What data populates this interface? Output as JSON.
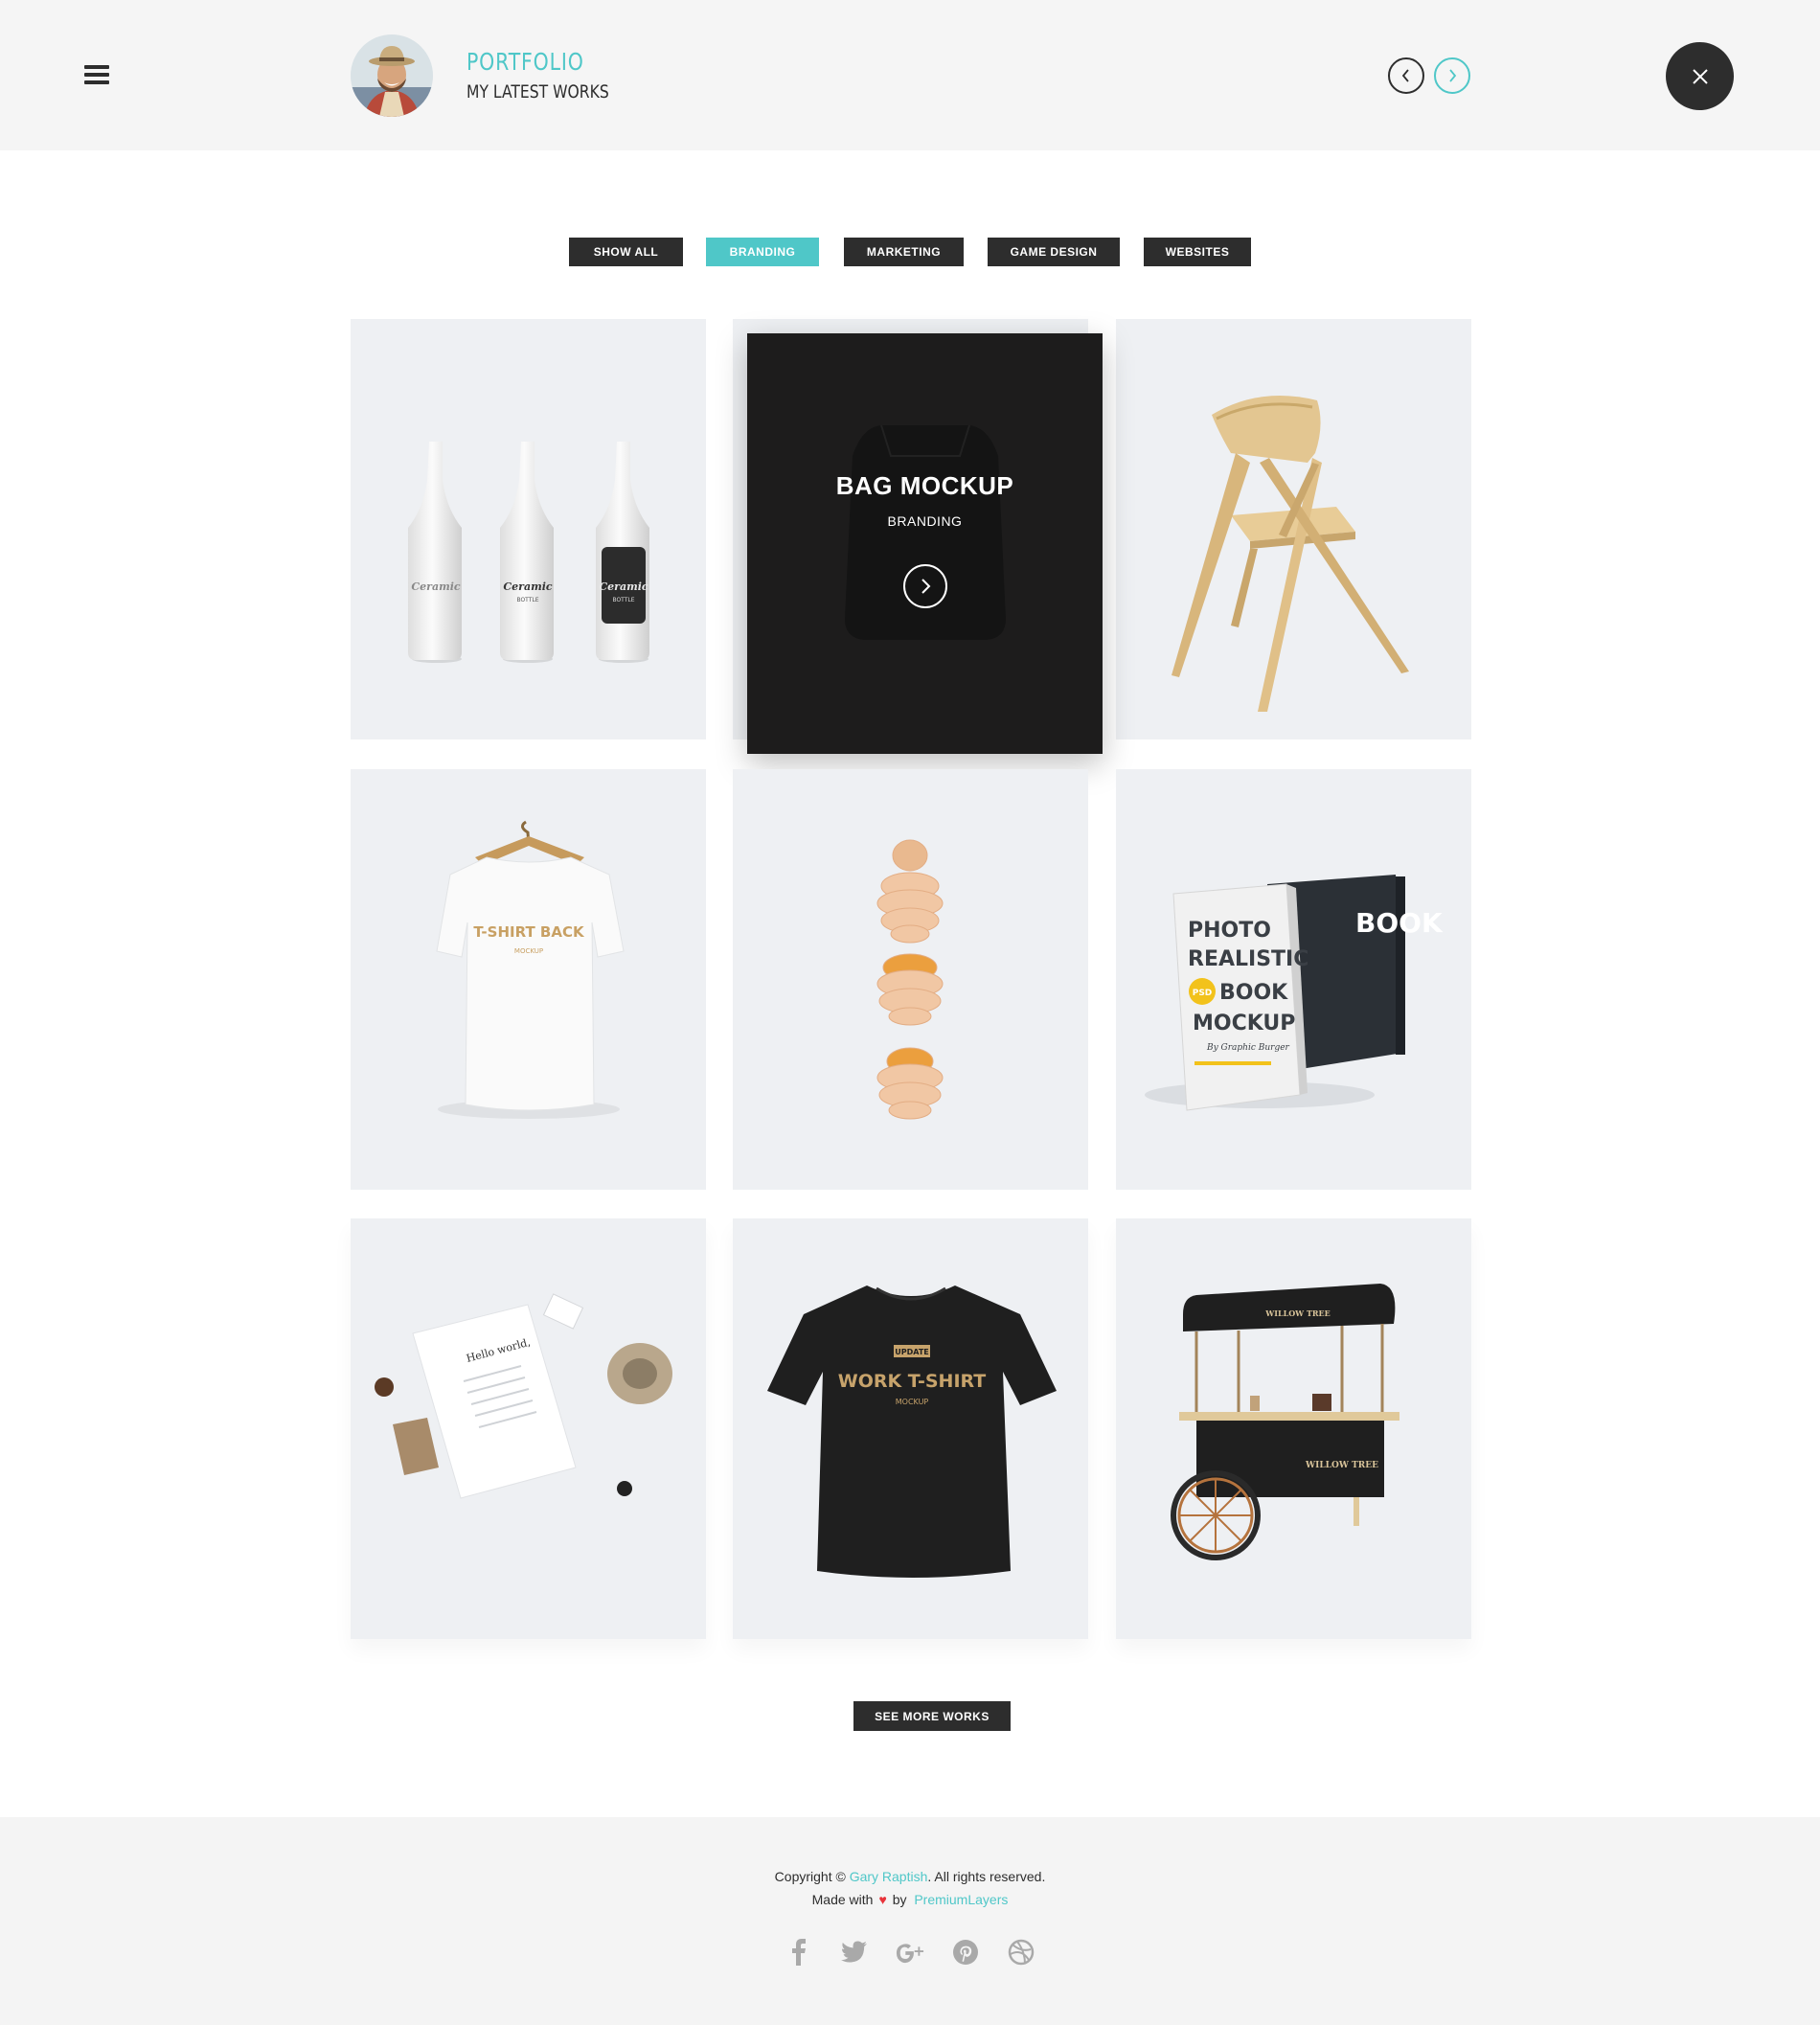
{
  "header": {
    "title": "PORTFOLIO",
    "subtitle": "MY LATEST WORKS"
  },
  "icons": {
    "menu": "hamburger-menu-icon",
    "prev": "chevron-left-icon",
    "next": "chevron-right-icon",
    "close": "close-icon"
  },
  "colors": {
    "accent": "#4fc7c8",
    "dark": "#2d2d2d",
    "tile_bg": "#eef0f3",
    "header_bg": "#f5f5f5",
    "heart": "#e8333a"
  },
  "filters": [
    {
      "label": "SHOW ALL",
      "active": false
    },
    {
      "label": "BRANDING",
      "active": true
    },
    {
      "label": "MARKETING",
      "active": false
    },
    {
      "label": "GAME DESIGN",
      "active": false
    },
    {
      "label": "WEBSITES",
      "active": false
    }
  ],
  "hovered_item": {
    "title": "BAG MOCKUP",
    "category": "BRANDING"
  },
  "image_text": {
    "bottle": "Ceramic",
    "bottle_sub": "BOTTLE",
    "tshirt_back": "T-SHIRT BACK",
    "tshirt_back_sub": "MOCKUP",
    "book_line1": "PHOTO",
    "book_line2": "REALISTIC",
    "book_line3": "BOOK",
    "book_line4": "MOCKUP",
    "book_badge": "PSD",
    "book_author": "By Graphic Burger",
    "letter": "Hello world,",
    "tshirt_badge": "UPDATE",
    "tshirt_front": "WORK T-SHIRT",
    "tshirt_front_sub": "MOCKUP",
    "cart_brand": "WILLOW TREE"
  },
  "see_more": "SEE MORE WORKS",
  "footer": {
    "copyright_prefix": "Copyright © ",
    "author": "Gary Raptish",
    "copyright_suffix": ". All rights reserved.",
    "made_with": "Made with",
    "by": "by",
    "company": "PremiumLayers",
    "socials": [
      "facebook-icon",
      "twitter-icon",
      "google-plus-icon",
      "pinterest-icon",
      "dribbble-icon"
    ]
  }
}
